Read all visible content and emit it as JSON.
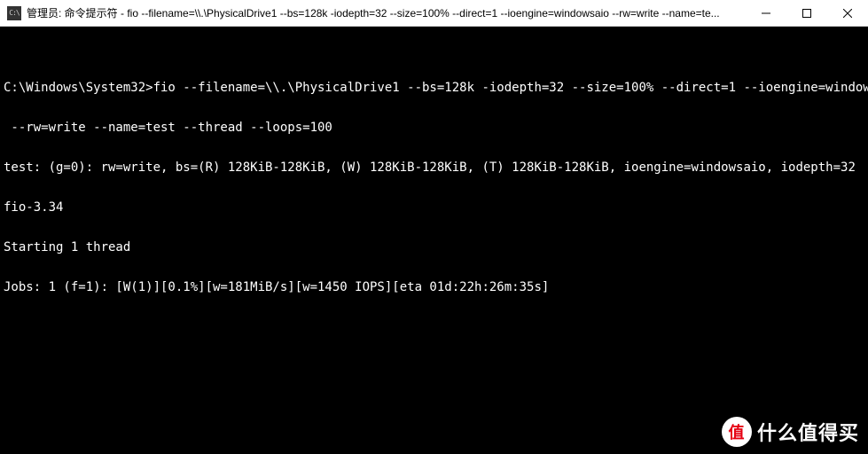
{
  "titlebar": {
    "icon_label": "C:\\",
    "title": "管理员: 命令提示符 - fio  --filename=\\\\.\\PhysicalDrive1 --bs=128k -iodepth=32 --size=100% --direct=1 --ioengine=windowsaio --rw=write --name=te..."
  },
  "console": {
    "lines": [
      "",
      "C:\\Windows\\System32>fio --filename=\\\\.\\PhysicalDrive1 --bs=128k -iodepth=32 --size=100% --direct=1 --ioengine=windowsaio",
      " --rw=write --name=test --thread --loops=100",
      "test: (g=0): rw=write, bs=(R) 128KiB-128KiB, (W) 128KiB-128KiB, (T) 128KiB-128KiB, ioengine=windowsaio, iodepth=32",
      "fio-3.34",
      "Starting 1 thread",
      "Jobs: 1 (f=1): [W(1)][0.1%][w=181MiB/s][w=1450 IOPS][eta 01d:22h:26m:35s]"
    ]
  },
  "watermark": {
    "badge": "值",
    "text": "什么值得买"
  }
}
